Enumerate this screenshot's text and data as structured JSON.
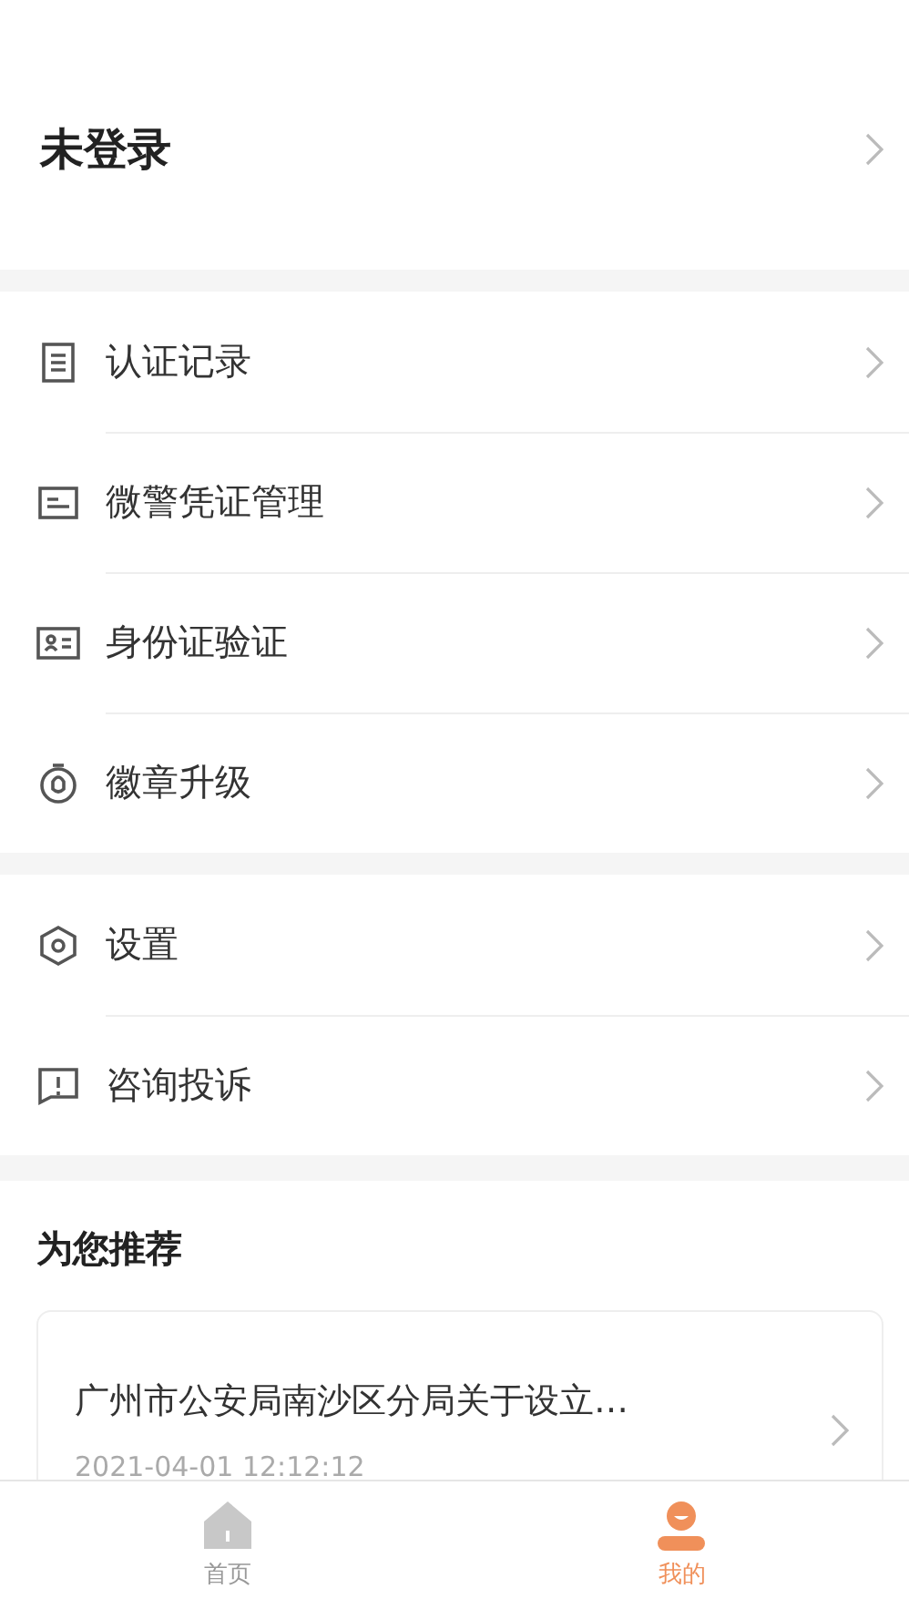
{
  "account": {
    "label": "未登录"
  },
  "menu_groups": [
    {
      "items": [
        {
          "kind": "document",
          "label": "认证记录"
        },
        {
          "kind": "card",
          "label": "微警凭证管理"
        },
        {
          "kind": "id-card",
          "label": "身份证验证"
        },
        {
          "kind": "badge",
          "label": "徽章升级"
        }
      ]
    },
    {
      "items": [
        {
          "kind": "settings",
          "label": "设置"
        },
        {
          "kind": "alert",
          "label": "咨询投诉"
        }
      ]
    }
  ],
  "recommend": {
    "title": "为您推荐",
    "articles": [
      {
        "title": "广州市公安局南沙区分局关于设立…",
        "time": "2021-04-01 12:12:12"
      }
    ]
  },
  "tab_bar": [
    {
      "kind": "home",
      "label": "首页",
      "selected": false
    },
    {
      "kind": "person",
      "label": "我的",
      "selected": true
    }
  ]
}
